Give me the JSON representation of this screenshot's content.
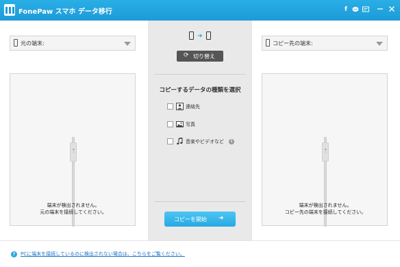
{
  "app": {
    "title": "FonePaw スマホ データ移行",
    "brand_color": "#1d9bd8",
    "toolbar_icons": [
      "facebook-icon",
      "chat-icon",
      "feedback-icon",
      "minimize-icon",
      "close-icon"
    ]
  },
  "source": {
    "select_label": "元の端末:",
    "message_line1": "端末が検出されません。",
    "message_line2": "元の端末を接続してください。"
  },
  "target": {
    "select_label": "コピー先の端末:",
    "message_line1": "端末が検出されません。",
    "message_line2": "コピー先の端末を接続してください。"
  },
  "center": {
    "switch_label": "切り替え",
    "select_title": "コピーするデータの種類を選択",
    "options": [
      {
        "label": "連絡先",
        "icon": "contact-icon",
        "checked": false
      },
      {
        "label": "写真",
        "icon": "photo-icon",
        "checked": false
      },
      {
        "label": "音楽やビデオなど",
        "icon": "music-icon",
        "checked": false
      }
    ],
    "start_label": "コピーを開始"
  },
  "footer": {
    "help_text": "PCに端末を接続しているのに検出されない場合は、こちらをご覧ください。"
  }
}
